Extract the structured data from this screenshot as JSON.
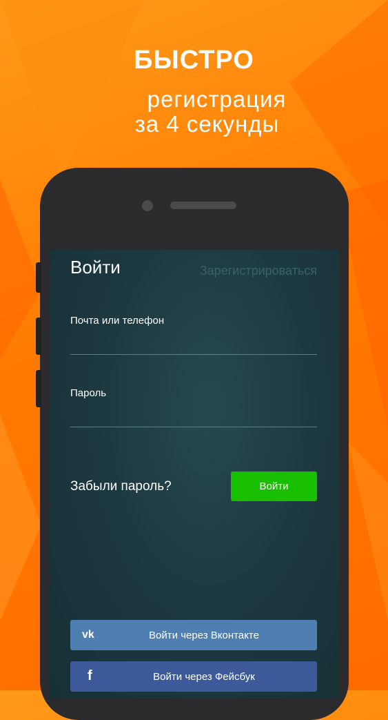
{
  "promo": {
    "headline": "БЫСТРО",
    "subline_1": "регистрация",
    "subline_2": "за 4 секунды"
  },
  "screen": {
    "title": "Войти",
    "register_link": "Зарегистрироваться",
    "email_label": "Почта или телефон",
    "password_label": "Пароль",
    "forgot_link": "Забыли пароль?",
    "login_button": "Войти",
    "vk_button": "Войти через Вконтакте",
    "fb_button": "Войти через Фейсбук"
  },
  "icons": {
    "vk": "vk-logo-icon",
    "fb": "facebook-logo-icon"
  },
  "colors": {
    "background": "#ff7b00",
    "login_green": "#19c000",
    "vk_blue": "#4f7fb1",
    "fb_blue": "#3c5a99"
  }
}
